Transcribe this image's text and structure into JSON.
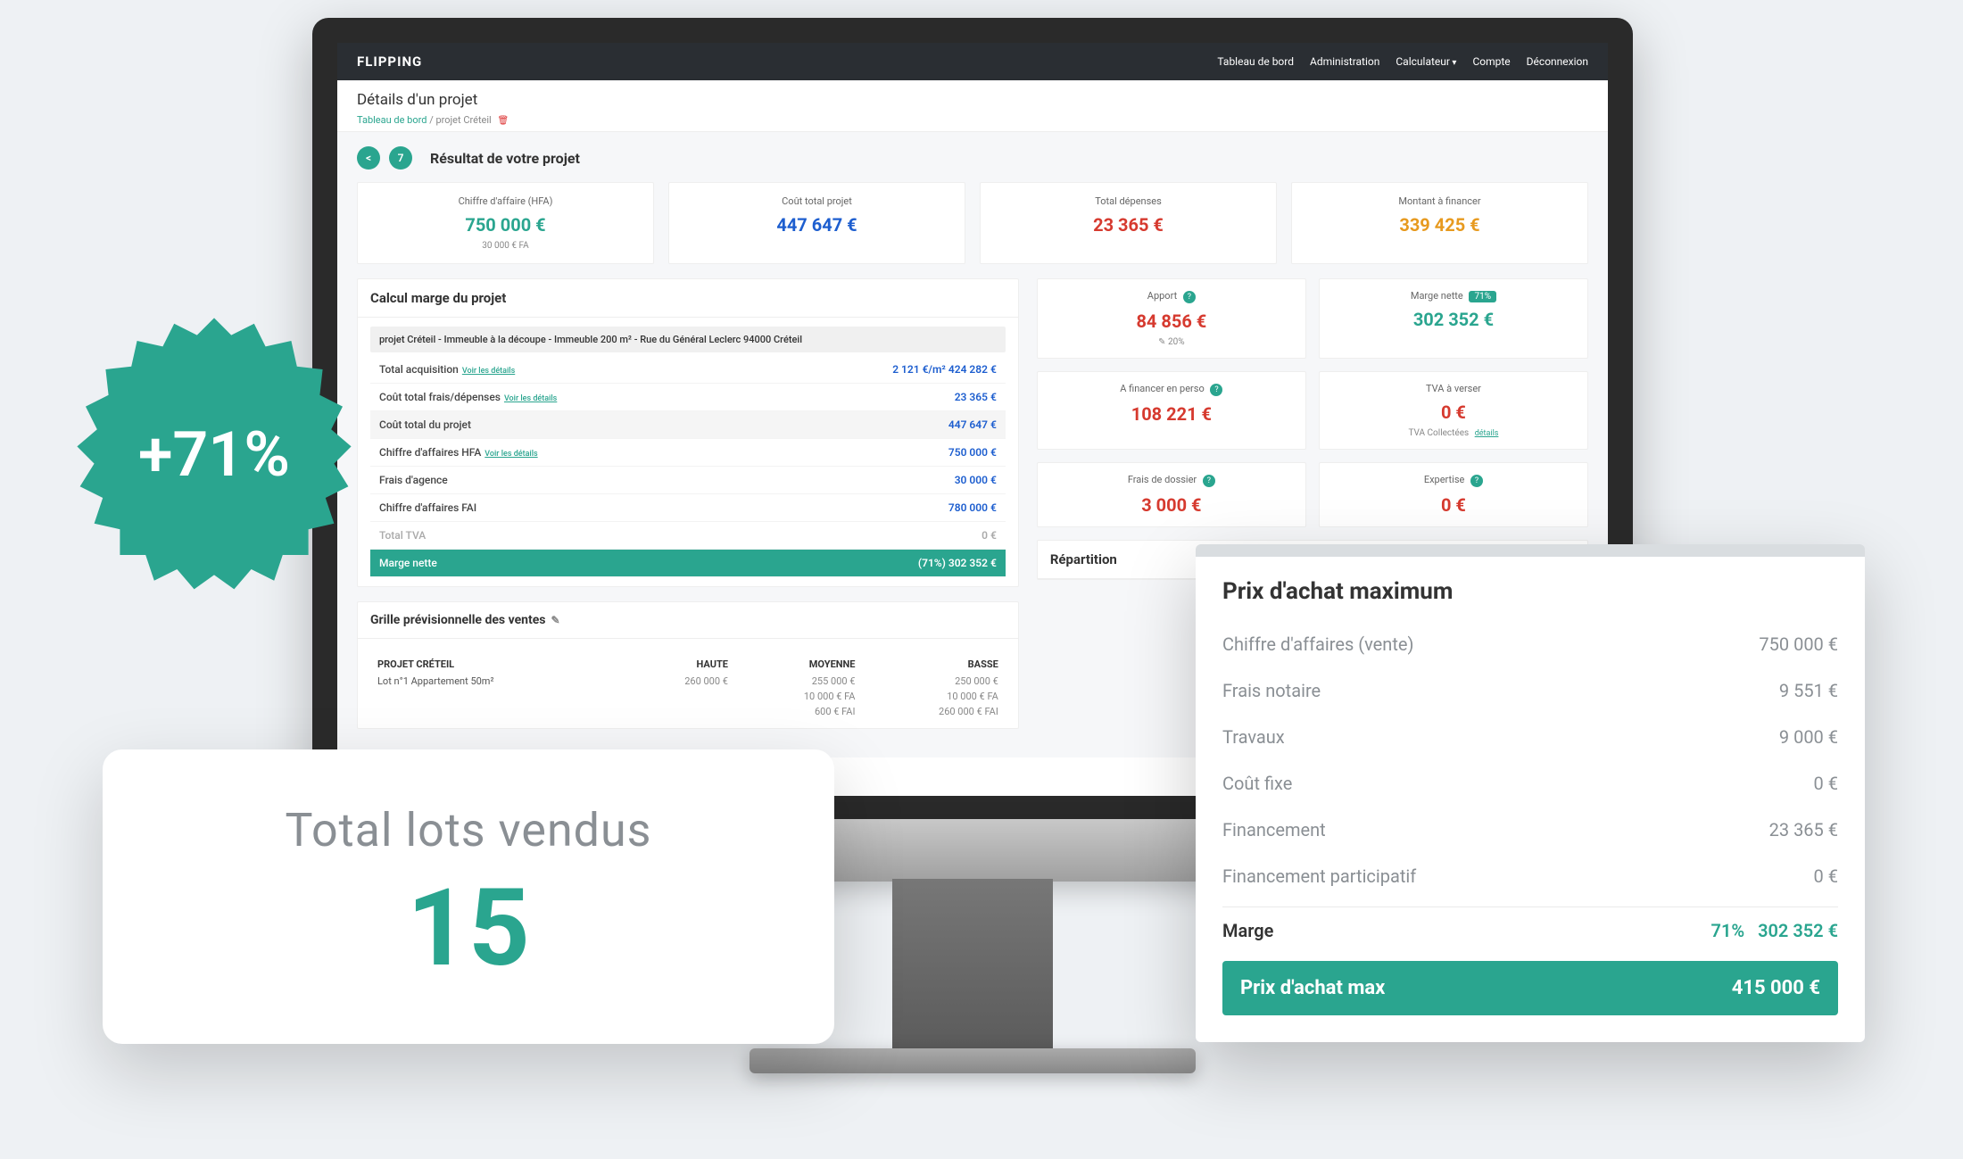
{
  "nav": {
    "brand": "FLIPPING",
    "items": [
      "Tableau de bord",
      "Administration",
      "Calculateur",
      "Compte",
      "Déconnexion"
    ]
  },
  "header": {
    "title": "Détails d'un projet",
    "breadcrumb_root": "Tableau de bord",
    "breadcrumb_sep": "/",
    "breadcrumb_current": "projet Créteil"
  },
  "step": {
    "prev": "<",
    "num": "7",
    "title": "Résultat de votre projet"
  },
  "kpi": {
    "ca_label": "Chiffre d'affaire (HFA)",
    "ca_value": "750 000 €",
    "ca_sub": "30 000 € FA",
    "cout_label": "Coût total projet",
    "cout_value": "447 647 €",
    "dep_label": "Total dépenses",
    "dep_value": "23 365 €",
    "fin_label": "Montant à financer",
    "fin_value": "339 425 €"
  },
  "right": {
    "apport_label": "Apport",
    "apport_value": "84 856 €",
    "apport_sub": "20%",
    "marge_label": "Marge nette",
    "marge_badge": "71%",
    "marge_value": "302 352 €",
    "fp_label": "A financer en perso",
    "fp_value": "108 221 €",
    "tva_label": "TVA à verser",
    "tva_value": "0 €",
    "tva_sub": "TVA Collectées",
    "tva_sub_link": "détails",
    "fd_label": "Frais de dossier",
    "fd_value": "3 000 €",
    "exp_label": "Expertise",
    "exp_value": "0 €",
    "repartition_title": "Répartition"
  },
  "calc": {
    "title": "Calcul marge du projet",
    "project_line": "projet Créteil - Immeuble à la découpe - Immeuble 200 m² - Rue du Général Leclerc 94000 Créteil",
    "rows": [
      {
        "label": "Total acquisition",
        "value": "2 121 €/m² 424 282 €",
        "link": "Voir les détails"
      },
      {
        "label": "Coût total frais/dépenses",
        "value": "23 365 €",
        "link": "Voir les détails"
      },
      {
        "label": "Coût total du projet",
        "value": "447 647 €",
        "shade": true
      },
      {
        "label": "Chiffre d'affaires HFA",
        "value": "750 000 €",
        "link": "Voir les détails"
      },
      {
        "label": "Frais d'agence",
        "value": "30 000 €"
      },
      {
        "label": "Chiffre d'affaires FAI",
        "value": "780 000 €"
      }
    ],
    "tva_label": "Total TVA",
    "tva_value": "0 €",
    "marge_label": "Marge nette",
    "marge_value": "(71%) 302 352 €"
  },
  "grille": {
    "title": "Grille prévisionnelle des ventes",
    "col_proj": "PROJET CRÉTEIL",
    "col_haute": "HAUTE",
    "col_moy": "MOYENNE",
    "col_basse": "BASSE",
    "row_label": "Lot n°1 Appartement 50m²",
    "h1": "260 000 €",
    "m1": "255 000 €",
    "b1": "250 000 €",
    "m2": "10 000 € FA",
    "b2": "10 000 € FA",
    "m3": "600 € FAI",
    "b3": "260 000 € FAI"
  },
  "burst": {
    "text": "+71%"
  },
  "lots": {
    "title": "Total lots vendus",
    "value": "15"
  },
  "prix": {
    "title": "Prix d'achat maximum",
    "rows": [
      {
        "l": "Chiffre d'affaires (vente)",
        "r": "750 000 €"
      },
      {
        "l": "Frais notaire",
        "r": "9 551 €"
      },
      {
        "l": "Travaux",
        "r": "9 000 €"
      },
      {
        "l": "Coût fixe",
        "r": "0 €"
      },
      {
        "l": "Financement",
        "r": "23 365 €"
      },
      {
        "l": "Financement participatif",
        "r": "0 €"
      }
    ],
    "marge_l": "Marge",
    "marge_pct": "71%",
    "marge_val": "302 352 €",
    "bar_l": "Prix d'achat max",
    "bar_r": "415 000 €"
  }
}
